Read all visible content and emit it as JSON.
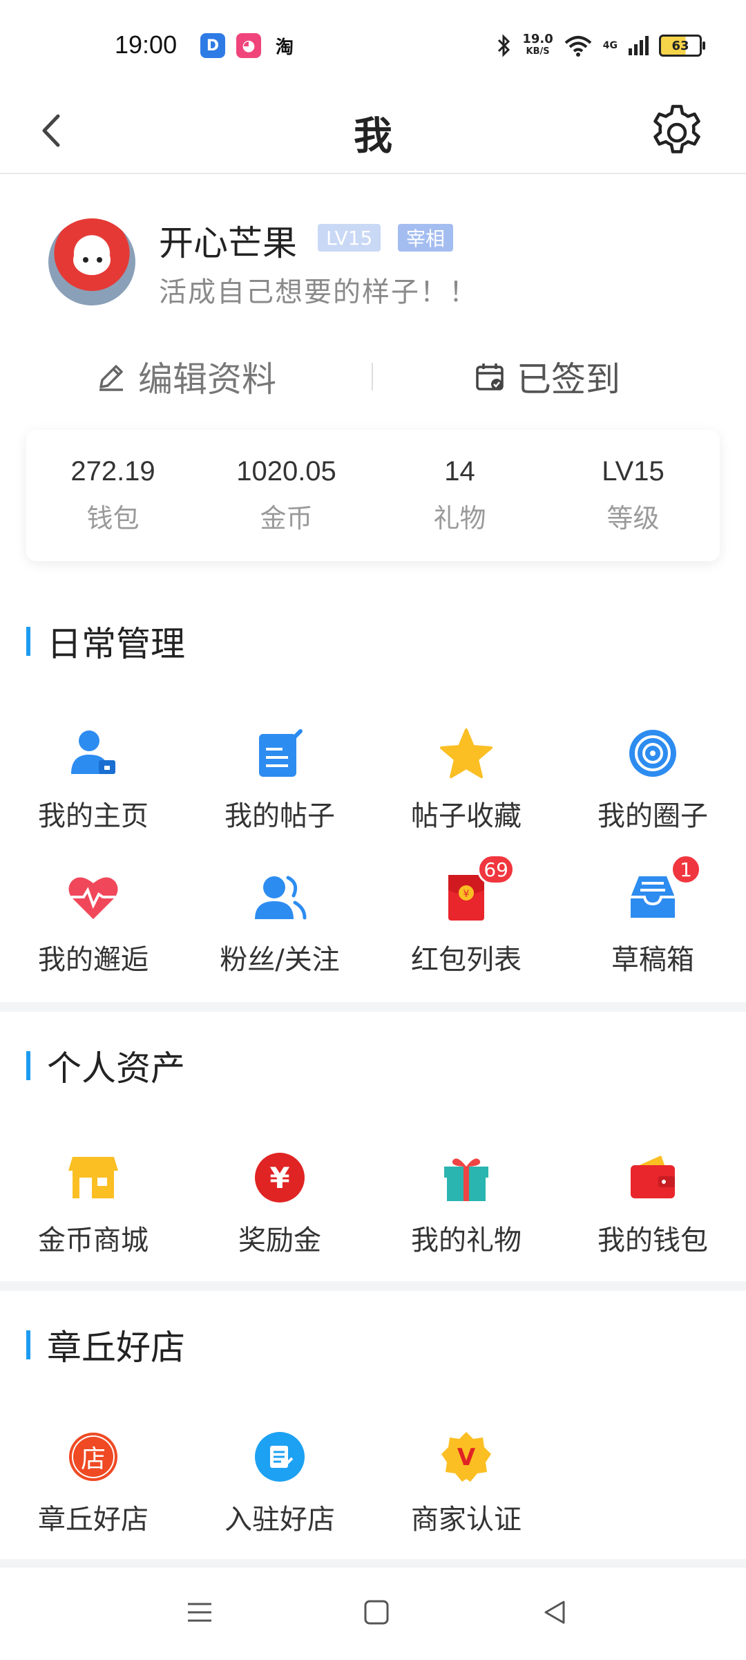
{
  "status_bar": {
    "time": "19:00",
    "apps": [
      "D",
      "◕",
      "淘"
    ],
    "speed_value": "19.0",
    "speed_unit": "KB/S",
    "network": "4G",
    "battery": "63"
  },
  "header": {
    "title": "我"
  },
  "profile": {
    "name": "开心芒果",
    "level_badge": "LV15",
    "title_badge": "宰相",
    "signature": "活成自己想要的样子！！",
    "edit_label": "编辑资料",
    "checkin_label": "已签到"
  },
  "stats": [
    {
      "value": "272.19",
      "label": "钱包"
    },
    {
      "value": "1020.05",
      "label": "金币"
    },
    {
      "value": "14",
      "label": "礼物"
    },
    {
      "value": "LV15",
      "label": "等级"
    }
  ],
  "sections": {
    "daily": {
      "title": "日常管理",
      "items": [
        {
          "label": "我的主页",
          "icon": "user-home-icon"
        },
        {
          "label": "我的帖子",
          "icon": "post-icon"
        },
        {
          "label": "帖子收藏",
          "icon": "star-icon"
        },
        {
          "label": "我的圈子",
          "icon": "circle-icon"
        },
        {
          "label": "我的邂逅",
          "icon": "heart-pulse-icon"
        },
        {
          "label": "粉丝/关注",
          "icon": "fans-icon"
        },
        {
          "label": "红包列表",
          "icon": "red-packet-icon",
          "badge": "69"
        },
        {
          "label": "草稿箱",
          "icon": "draft-box-icon",
          "badge": "1"
        }
      ]
    },
    "assets": {
      "title": "个人资产",
      "items": [
        {
          "label": "金币商城",
          "icon": "shop-icon"
        },
        {
          "label": "奖励金",
          "icon": "yen-icon",
          "glyph": "¥"
        },
        {
          "label": "我的礼物",
          "icon": "gift-icon"
        },
        {
          "label": "我的钱包",
          "icon": "wallet-icon"
        }
      ]
    },
    "stores": {
      "title": "章丘好店",
      "items": [
        {
          "label": "章丘好店",
          "icon": "store-icon",
          "glyph": "店"
        },
        {
          "label": "入驻好店",
          "icon": "join-store-icon"
        },
        {
          "label": "商家认证",
          "icon": "merchant-verify-icon",
          "glyph": "V"
        }
      ]
    }
  },
  "colors": {
    "accent": "#1d9bf0",
    "badge_red": "#f0363e"
  }
}
